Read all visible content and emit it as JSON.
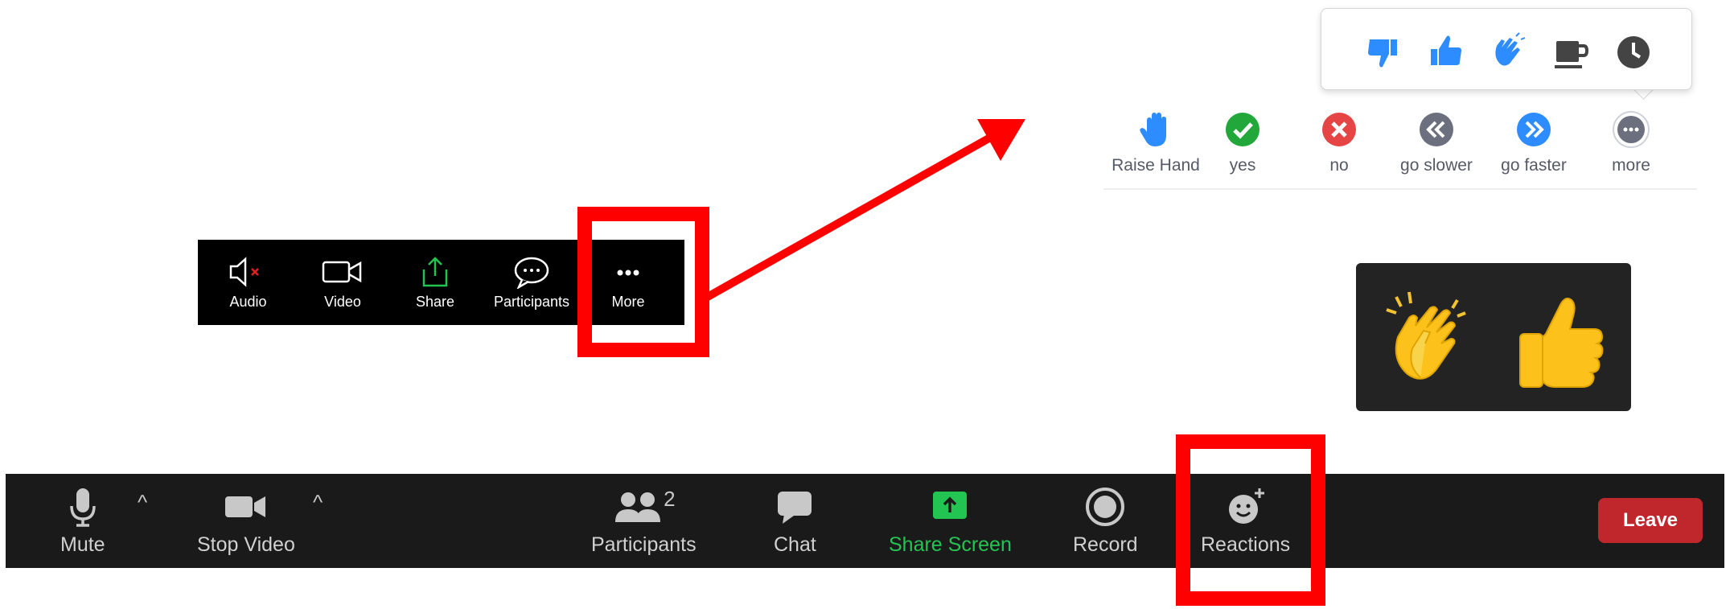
{
  "mobile_toolbar": {
    "audio_label": "Audio",
    "video_label": "Video",
    "share_label": "Share",
    "participants_label": "Participants",
    "more_label": "More"
  },
  "reactions_popup": {
    "emojis": [
      "thumbs-down",
      "thumbs-up",
      "clapping-hands",
      "coffee",
      "clock"
    ]
  },
  "feedback_bar": {
    "items": [
      {
        "label": "Raise Hand",
        "icon": "raise-hand-icon",
        "color": "#2d8cff"
      },
      {
        "label": "yes",
        "icon": "check-icon",
        "color": "#22a83a"
      },
      {
        "label": "no",
        "icon": "x-icon",
        "color": "#e54545"
      },
      {
        "label": "go slower",
        "icon": "rewind-icon",
        "color": "#6b6f7e"
      },
      {
        "label": "go faster",
        "icon": "fast-forward-icon",
        "color": "#2d8cff"
      },
      {
        "label": "more",
        "icon": "ellipsis-icon",
        "color": "#6b6f7e"
      }
    ]
  },
  "reaction_tile": {
    "emojis": [
      "clapping-hands",
      "thumbs-up"
    ]
  },
  "desktop_toolbar": {
    "mute_label": "Mute",
    "stop_video_label": "Stop Video",
    "participants_label": "Participants",
    "participants_count": "2",
    "chat_label": "Chat",
    "share_screen_label": "Share Screen",
    "record_label": "Record",
    "reactions_label": "Reactions",
    "leave_label": "Leave"
  },
  "colors": {
    "highlight": "#ff0000",
    "share_green": "#23c552",
    "leave_red": "#c0272d"
  }
}
